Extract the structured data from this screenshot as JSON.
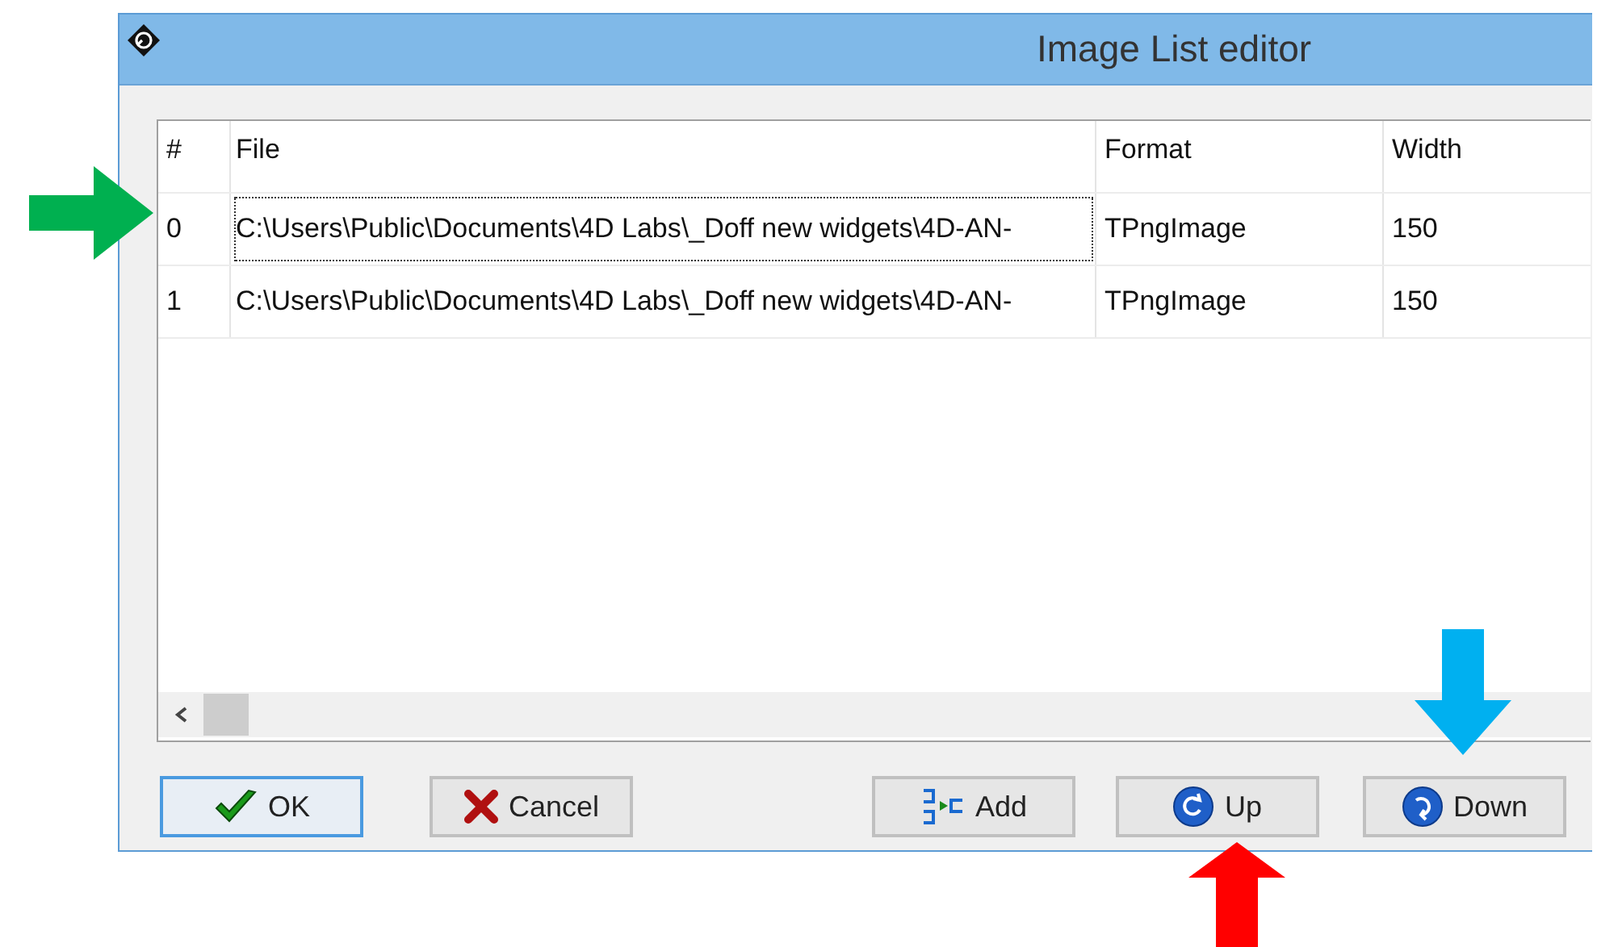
{
  "window": {
    "title": "Image List editor"
  },
  "table": {
    "columns": [
      "#",
      "File",
      "Format",
      "Width"
    ],
    "rows": [
      {
        "cells": [
          "0",
          "C:\\Users\\Public\\Documents\\4D Labs\\_Doff new widgets\\4D-AN-",
          "TPngImage",
          "150"
        ],
        "focused": true
      },
      {
        "cells": [
          "1",
          "C:\\Users\\Public\\Documents\\4D Labs\\_Doff new widgets\\4D-AN-",
          "TPngImage",
          "150"
        ],
        "focused": false
      }
    ]
  },
  "buttons": [
    {
      "label": "OK",
      "kind": "ok",
      "default": true
    },
    {
      "label": "Cancel",
      "kind": "cancel",
      "default": false
    },
    {
      "label": "Add",
      "kind": "add",
      "default": false
    },
    {
      "label": "Up",
      "kind": "up",
      "default": false
    },
    {
      "label": "Down",
      "kind": "down",
      "default": false
    }
  ],
  "annotations": [
    {
      "kind": "right",
      "color": "#00b050"
    },
    {
      "kind": "up",
      "color": "#ff0000"
    },
    {
      "kind": "down",
      "color": "#00b0f0"
    }
  ]
}
